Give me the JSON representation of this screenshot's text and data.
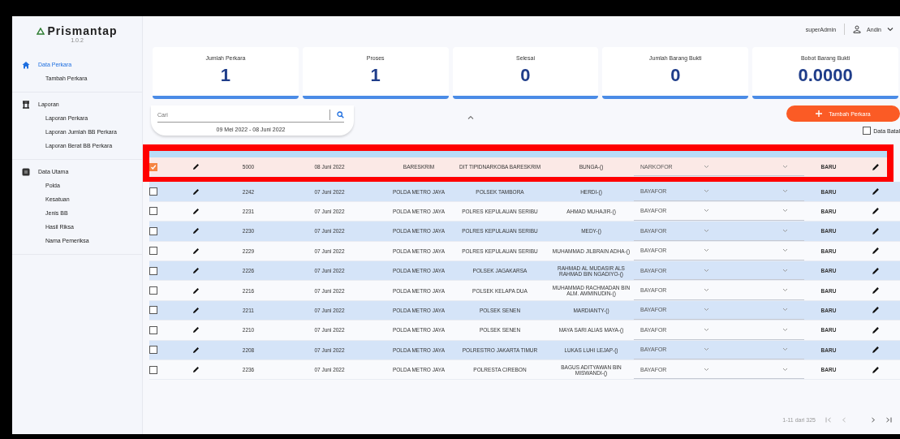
{
  "app": {
    "name": "Prismantap",
    "version": "1.0.2"
  },
  "sidebar": {
    "sections": [
      {
        "title": "Data Perkara",
        "selected": true,
        "items": [
          {
            "label": "Tambah Perkara",
            "selected": false
          }
        ]
      },
      {
        "title": "Laporan",
        "selected": false,
        "items": [
          {
            "label": "Laporan Perkara",
            "selected": false
          },
          {
            "label": "Laporan Jumlah BB Perkara",
            "selected": false
          },
          {
            "label": "Laporan Berat BB Perkara",
            "selected": false
          }
        ]
      },
      {
        "title": "Data Utama",
        "selected": false,
        "items": [
          {
            "label": "Polda",
            "selected": false
          },
          {
            "label": "Kesatuan",
            "selected": false
          },
          {
            "label": "Jenis BB",
            "selected": false
          },
          {
            "label": "Hasil Riksa",
            "selected": false
          },
          {
            "label": "Nama Pemeriksa",
            "selected": false
          }
        ]
      }
    ]
  },
  "header": {
    "role": "superAdmin",
    "user": "Andin"
  },
  "stats": [
    {
      "label": "Jumlah Perkara",
      "value": "1"
    },
    {
      "label": "Proses",
      "value": "1"
    },
    {
      "label": "Selesai",
      "value": "0"
    },
    {
      "label": "Jumlah Barang Bukti",
      "value": "0"
    },
    {
      "label": "Bobot Barang Bukti",
      "value": "0.0000"
    }
  ],
  "search": {
    "placeholder": "Cari",
    "date_range": "09 Mei 2022 - 08 Juni 2022"
  },
  "add_button": "Tambah Perkara",
  "filter": {
    "label": "Data Batal",
    "checked": false
  },
  "table": {
    "rows": [
      {
        "checked": true,
        "highlighted": true,
        "number": "5000",
        "date": "08 Juni 2022",
        "polda": "BARESKRIM",
        "satuan": "DIT TIPIDNARKOBA BARESKRIM",
        "name": "BUNGA-()",
        "type": "NARKOFOR",
        "status": "BARU"
      },
      {
        "checked": false,
        "highlighted": false,
        "number": "2242",
        "date": "07 Juni 2022",
        "polda": "POLDA METRO JAYA",
        "satuan": "POLSEK TAMBORA",
        "name": "HERDI-()",
        "type": "BAYAFOR",
        "status": "BARU"
      },
      {
        "checked": false,
        "highlighted": false,
        "number": "2231",
        "date": "07 Juni 2022",
        "polda": "POLDA METRO JAYA",
        "satuan": "POLRES KEPULAUAN SERIBU",
        "name": "AHMAD MUHAJIR-()",
        "type": "BAYAFOR",
        "status": "BARU"
      },
      {
        "checked": false,
        "highlighted": false,
        "number": "2230",
        "date": "07 Juni 2022",
        "polda": "POLDA METRO JAYA",
        "satuan": "POLRES KEPULAUAN SERIBU",
        "name": "MEDY-()",
        "type": "BAYAFOR",
        "status": "BARU"
      },
      {
        "checked": false,
        "highlighted": false,
        "number": "2229",
        "date": "07 Juni 2022",
        "polda": "POLDA METRO JAYA",
        "satuan": "POLRES KEPULAUAN SERIBU",
        "name": "MUHAMMAD JILBRAIN ADHA-()",
        "type": "BAYAFOR",
        "status": "BARU"
      },
      {
        "checked": false,
        "highlighted": false,
        "number": "2226",
        "date": "07 Juni 2022",
        "polda": "POLDA METRO JAYA",
        "satuan": "POLSEK JAGAKARSA",
        "name": "RAHMAD AL MUDASIR ALS RAHMAD BIN NGADIYO-()",
        "type": "BAYAFOR",
        "status": "BARU"
      },
      {
        "checked": false,
        "highlighted": false,
        "number": "2216",
        "date": "07 Juni 2022",
        "polda": "POLDA METRO JAYA",
        "satuan": "POLSEK KELAPA DUA",
        "name": "MUHAMMAD RACHMADAN BIN ALM. AMMINUDIN-()",
        "type": "BAYAFOR",
        "status": "BARU"
      },
      {
        "checked": false,
        "highlighted": false,
        "number": "2211",
        "date": "07 Juni 2022",
        "polda": "POLDA METRO JAYA",
        "satuan": "POLSEK SENEN",
        "name": "MARDIANTY-()",
        "type": "BAYAFOR",
        "status": "BARU"
      },
      {
        "checked": false,
        "highlighted": false,
        "number": "2210",
        "date": "07 Juni 2022",
        "polda": "POLDA METRO JAYA",
        "satuan": "POLSEK SENEN",
        "name": "MAYA SARI ALIAS MAYA-()",
        "type": "BAYAFOR",
        "status": "BARU"
      },
      {
        "checked": false,
        "highlighted": false,
        "number": "2208",
        "date": "07 Juni 2022",
        "polda": "POLDA METRO JAYA",
        "satuan": "POLRESTRO JAKARTA TIMUR",
        "name": "LUKAS LUHI LEJAP-()",
        "type": "BAYAFOR",
        "status": "BARU"
      },
      {
        "checked": false,
        "highlighted": false,
        "number": "2236",
        "date": "07 Juni 2022",
        "polda": "POLDA METRO JAYA",
        "satuan": "POLRESTA CIREBON",
        "name": "BAGUS ADITYAWAN BIN MISWANDI-()",
        "type": "BAYAFOR",
        "status": "BARU"
      }
    ]
  },
  "pagination": {
    "range": "1-11 dari 325"
  }
}
